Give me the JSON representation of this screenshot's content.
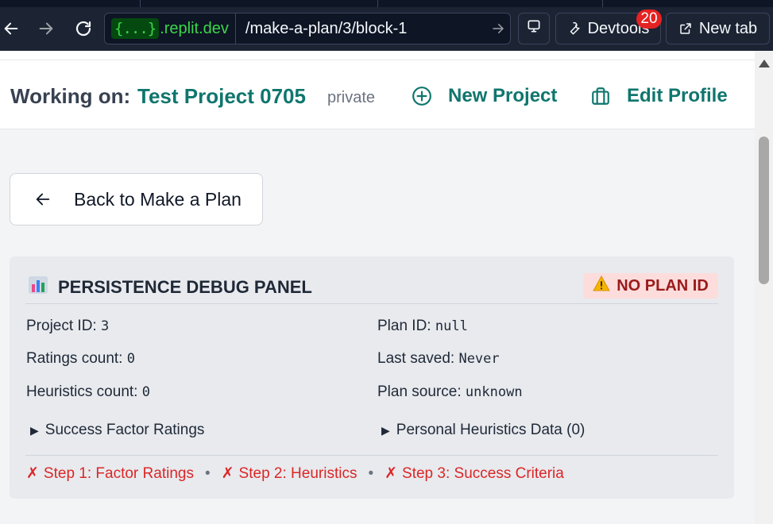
{
  "browser": {
    "url_badge": "{...}",
    "url_domain": ".replit.dev",
    "url_path": "/make-a-plan/3/block-1",
    "devtools_label": "Devtools",
    "devtools_count": "20",
    "new_tab_label": "New tab"
  },
  "header": {
    "working_on_label": "Working on:",
    "project_name": "Test Project 0705",
    "visibility": "private",
    "new_project_label": "New Project",
    "edit_profile_label": "Edit Profile"
  },
  "back_button": {
    "label": "Back to Make a Plan"
  },
  "debug_panel": {
    "title": "PERSISTENCE DEBUG PANEL",
    "status_badge": "NO PLAN ID",
    "project_id_label": "Project ID:",
    "project_id_value": "3",
    "plan_id_label": "Plan ID:",
    "plan_id_value": "null",
    "ratings_count_label": "Ratings count:",
    "ratings_count_value": "0",
    "last_saved_label": "Last saved:",
    "last_saved_value": "Never",
    "heuristics_count_label": "Heuristics count:",
    "heuristics_count_value": "0",
    "plan_source_label": "Plan source:",
    "plan_source_value": "unknown",
    "success_factor_ratings_label": "Success Factor Ratings",
    "personal_heuristics_label": "Personal Heuristics Data (0)",
    "steps": [
      {
        "mark": "✗",
        "label": "Step 1: Factor Ratings"
      },
      {
        "mark": "✗",
        "label": "Step 2: Heuristics"
      },
      {
        "mark": "✗",
        "label": "Step 3: Success Criteria"
      }
    ],
    "step_separator": "•"
  },
  "colors": {
    "accent_teal": "#0f766e",
    "error_red": "#dc2626",
    "badge_bg": "#fddcdc"
  }
}
